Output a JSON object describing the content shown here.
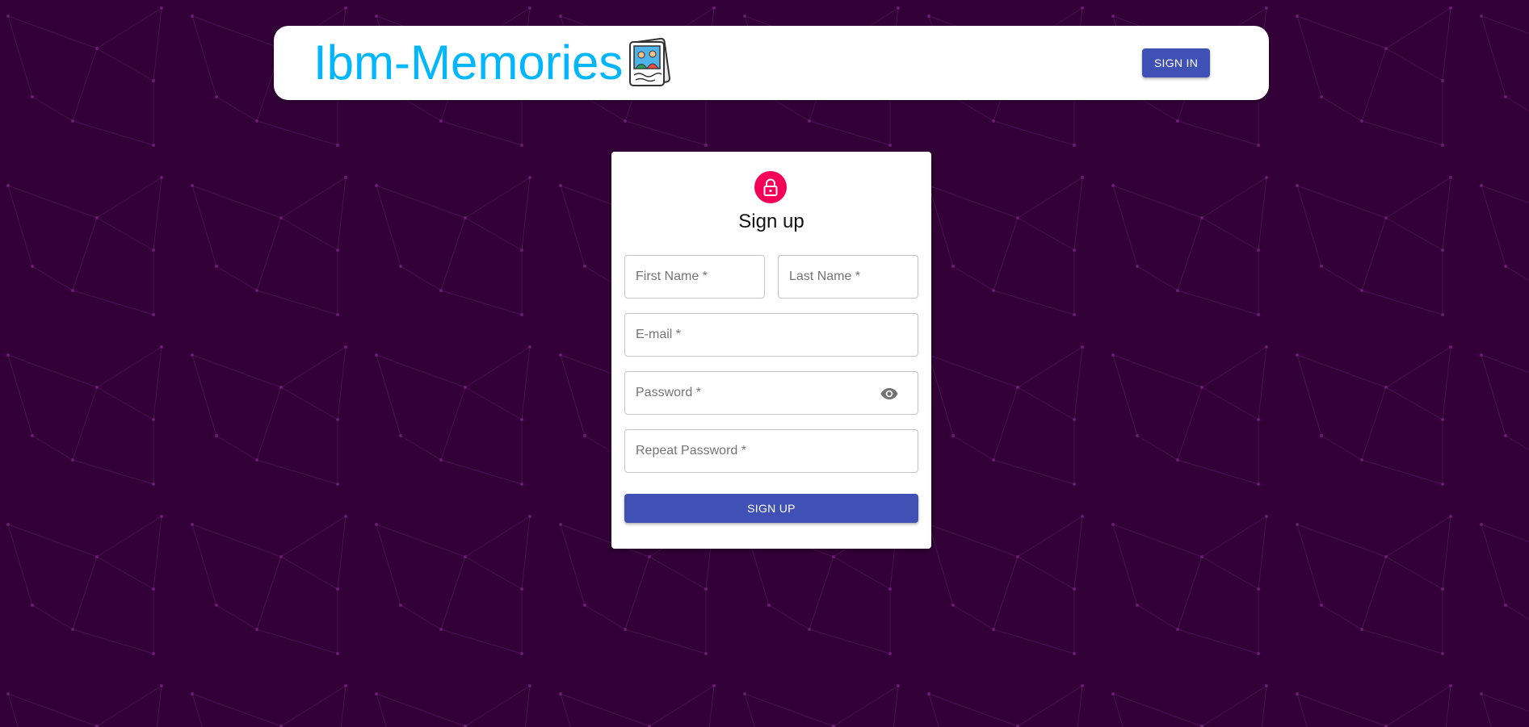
{
  "header": {
    "brand_title": "Ibm-Memories",
    "logo_icon": "photo-album-icon",
    "signin_label": "SIGN IN"
  },
  "signup": {
    "lock_icon": "lock-icon",
    "title": "Sign up",
    "first_name": {
      "placeholder": "First Name *",
      "value": ""
    },
    "last_name": {
      "placeholder": "Last Name *",
      "value": ""
    },
    "email": {
      "placeholder": "E-mail *",
      "value": ""
    },
    "password": {
      "placeholder": "Password *",
      "value": ""
    },
    "password_toggle_icon": "eye-icon",
    "repeat_password": {
      "placeholder": "Repeat Password *",
      "value": ""
    },
    "submit_label": "SIGN UP"
  },
  "colors": {
    "background": "#320037",
    "brand_text": "#00b7ff",
    "primary": "#3f51b5",
    "avatar": "#f50057"
  }
}
